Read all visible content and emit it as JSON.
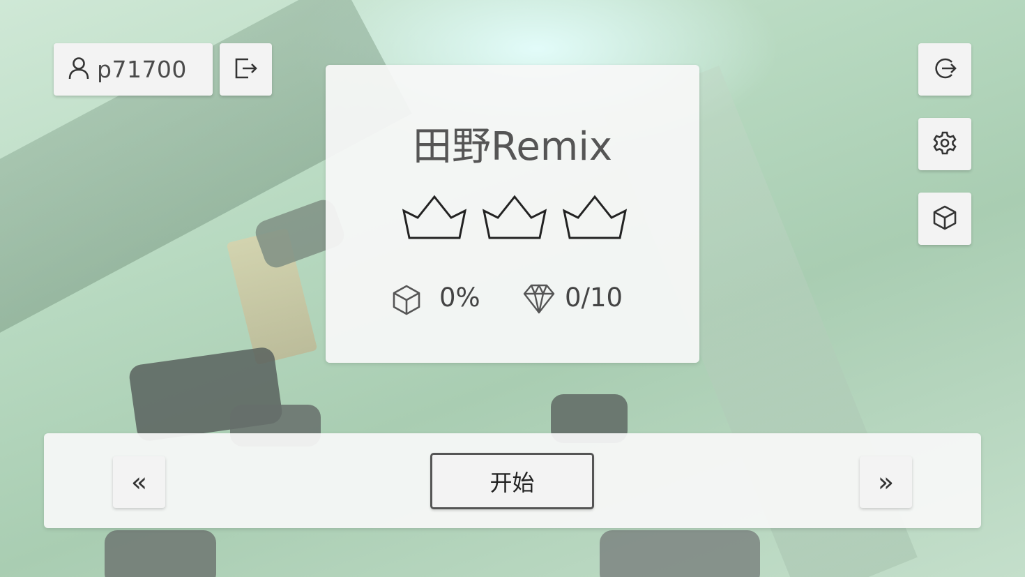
{
  "user": {
    "name": "p71700"
  },
  "level": {
    "title": "田野Remix",
    "crowns_earned": 0,
    "crowns_total": 3,
    "progress": "0%",
    "gems": "0/10"
  },
  "buttons": {
    "start": "开始",
    "prev": "«",
    "next": "»"
  },
  "icons": {
    "user": "user-icon",
    "exit": "exit-icon",
    "logout": "logout-icon",
    "settings": "gear-icon",
    "cube": "cube-icon",
    "crown": "crown-icon",
    "gem": "diamond-icon"
  }
}
